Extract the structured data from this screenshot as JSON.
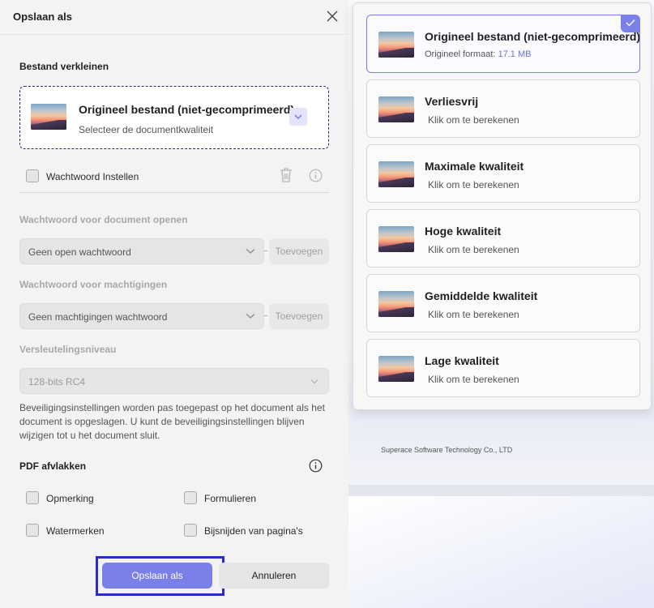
{
  "dialog": {
    "title": "Opslaan als",
    "compress_section_title": "Bestand verkleinen",
    "quality_select": {
      "title": "Origineel bestand (niet-gecomprimeerd)",
      "subtitle": "Selecteer de documentkwaliteit"
    },
    "password_checkbox_label": "Wachtwoord Instellen",
    "open_password": {
      "title": "Wachtwoord voor document openen",
      "value": "Geen open wachtwoord",
      "add_label": "Toevoegen"
    },
    "permission_password": {
      "title": "Wachtwoord voor machtigingen",
      "value": "Geen machtigingen wachtwoord",
      "add_label": "Toevoegen"
    },
    "encryption": {
      "title": "Versleutelingsniveau",
      "value": "128-bits RC4"
    },
    "info_text": "Beveiligingsinstellingen worden pas toegepast op het document als het document is opgeslagen. U kunt de beveiligingsinstellingen blijven wijzigen tot u het document sluit.",
    "flatten": {
      "title": "PDF afvlakken",
      "items": [
        "Opmerking",
        "Formulieren",
        "Watermerken",
        "Bijsnijden van pagina's"
      ]
    },
    "save_button": "Opslaan als",
    "cancel_button": "Annuleren"
  },
  "quality_panel": {
    "options": [
      {
        "title": "Origineel bestand (niet-gecomprimeerd)",
        "sub_label": "Origineel formaat:",
        "sub_value": "17.1 MB",
        "selected": true
      },
      {
        "title": "Verliesvrij",
        "sub": "Klik om te berekenen"
      },
      {
        "title": "Maximale kwaliteit",
        "sub": "Klik om te berekenen"
      },
      {
        "title": "Hoge kwaliteit",
        "sub": "Klik om te berekenen"
      },
      {
        "title": "Gemiddelde kwaliteit",
        "sub": "Klik om te berekenen"
      },
      {
        "title": "Lage kwaliteit",
        "sub": "Klik om te berekenen"
      }
    ]
  },
  "background": {
    "company": "Superace Software Technology Co., LTD"
  },
  "colors": {
    "accent": "#7b7fe8",
    "highlight_border": "#2b2bc7"
  }
}
